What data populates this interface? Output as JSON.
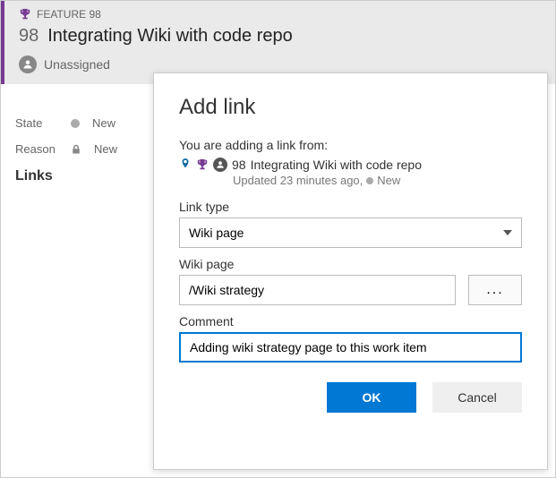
{
  "header": {
    "type_label": "FEATURE 98",
    "id": "98",
    "title": "Integrating Wiki with code repo",
    "assigned": "Unassigned"
  },
  "fields": {
    "state_label": "State",
    "state_value": "New",
    "reason_label": "Reason",
    "reason_value": "New"
  },
  "links_heading": "Links",
  "dialog": {
    "title": "Add link",
    "intro": "You are adding a link from:",
    "item_id": "98",
    "item_title": "Integrating Wiki with code repo",
    "updated": "Updated 23 minutes ago,",
    "status": "New",
    "link_type_label": "Link type",
    "link_type_value": "Wiki page",
    "wiki_page_label": "Wiki page",
    "wiki_page_value": "/Wiki strategy",
    "browse_label": "...",
    "comment_label": "Comment",
    "comment_value": "Adding wiki strategy page to this work item",
    "ok_label": "OK",
    "cancel_label": "Cancel"
  }
}
